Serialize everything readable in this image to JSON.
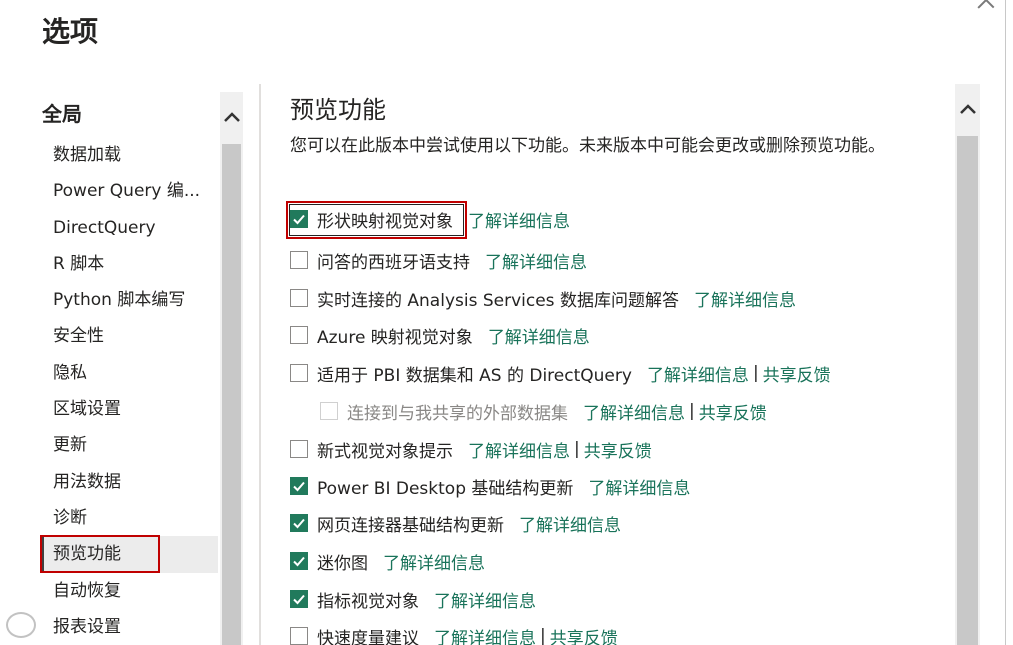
{
  "dialog": {
    "title": "选项"
  },
  "nav": {
    "group": "全局",
    "items": [
      {
        "label": "数据加载"
      },
      {
        "label": "Power Query 编..."
      },
      {
        "label": "DirectQuery"
      },
      {
        "label": "R 脚本"
      },
      {
        "label": "Python 脚本编写"
      },
      {
        "label": "安全性"
      },
      {
        "label": "隐私"
      },
      {
        "label": "区域设置"
      },
      {
        "label": "更新"
      },
      {
        "label": "用法数据"
      },
      {
        "label": "诊断"
      },
      {
        "label": "预览功能"
      },
      {
        "label": "自动恢复"
      },
      {
        "label": "报表设置"
      }
    ],
    "selected_index": 11
  },
  "content": {
    "title": "预览功能",
    "description": "您可以在此版本中尝试使用以下功能。未来版本中可能会更改或删除预览功能。",
    "link_learn": "了解详细信息",
    "link_feedback": "共享反馈",
    "separator": "|",
    "features": [
      {
        "label": "形状映射视觉对象",
        "checked": true
      },
      {
        "label": "问答的西班牙语支持",
        "checked": false
      },
      {
        "label": "实时连接的 Analysis Services 数据库问题解答",
        "checked": false
      },
      {
        "label": "Azure 映射视觉对象",
        "checked": false
      },
      {
        "label": "适用于 PBI 数据集和 AS 的 DirectQuery",
        "checked": false
      },
      {
        "label": "连接到与我共享的外部数据集",
        "checked": false,
        "disabled": true
      },
      {
        "label": "新式视觉对象提示",
        "checked": false
      },
      {
        "label": "Power BI Desktop 基础结构更新",
        "checked": true
      },
      {
        "label": "网页连接器基础结构更新",
        "checked": true
      },
      {
        "label": "迷你图",
        "checked": true
      },
      {
        "label": "指标视觉对象",
        "checked": true
      },
      {
        "label": "快速度量建议",
        "checked": false
      }
    ]
  },
  "colors": {
    "accent": "#217a5c",
    "link": "#19735a",
    "highlight": "#c00000"
  },
  "icons": {
    "close": "close-icon",
    "scroll_up": "chevron-up-icon",
    "check": "checkmark-icon"
  }
}
